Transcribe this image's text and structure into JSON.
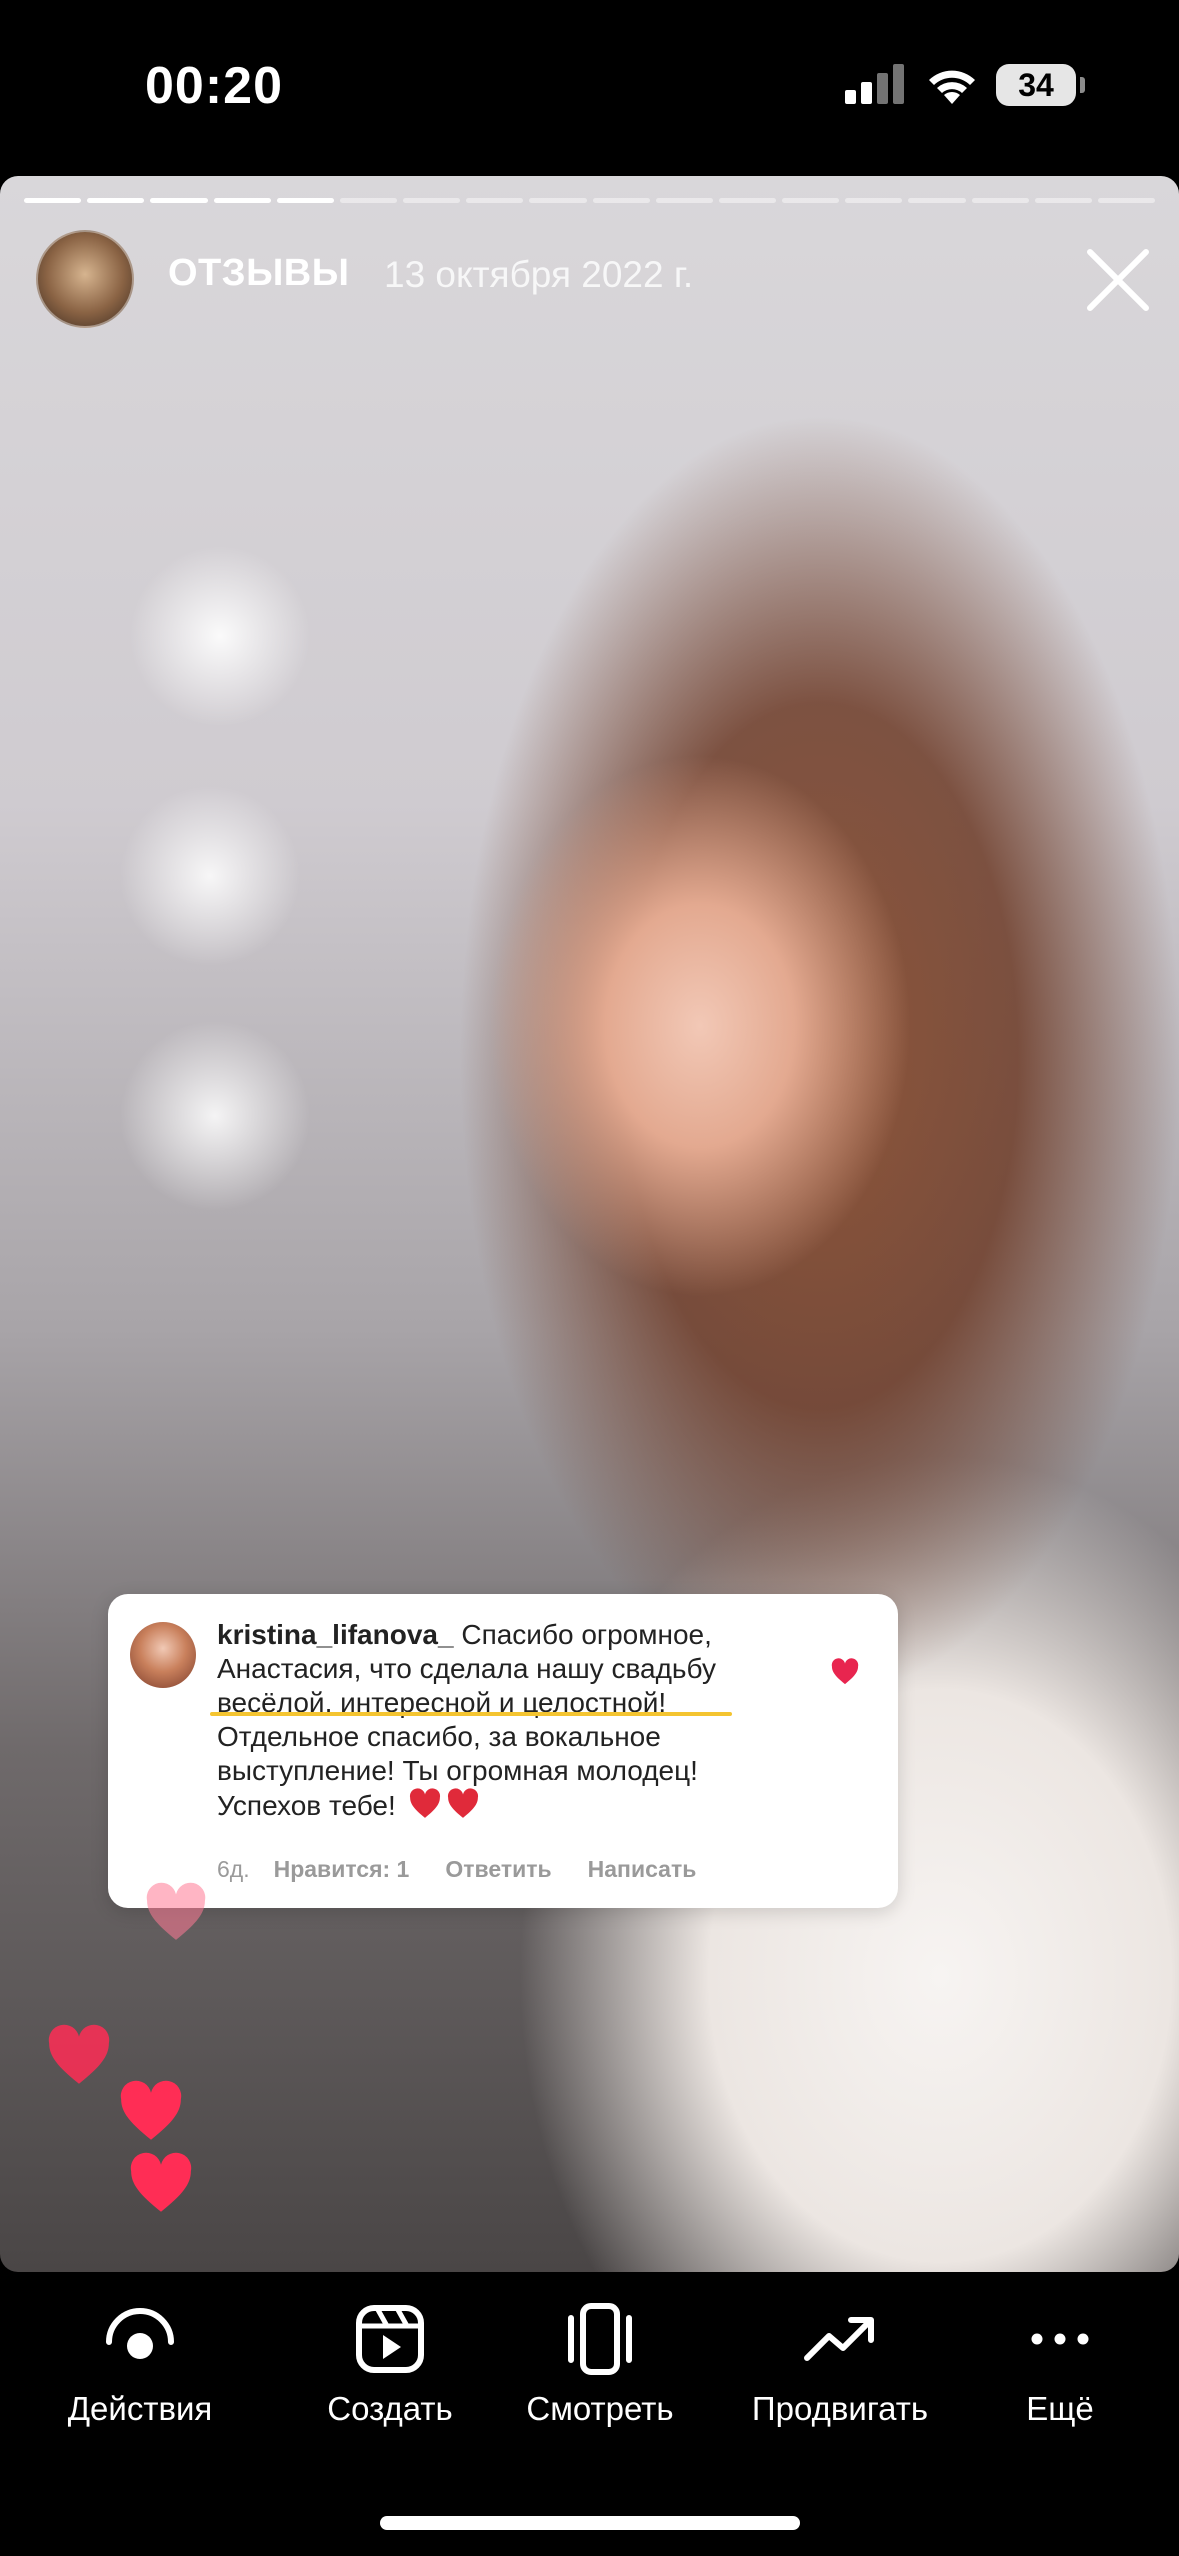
{
  "status_bar": {
    "time": "00:20",
    "battery": "34",
    "icons": [
      "cellular-signal-icon",
      "wifi-icon",
      "battery-icon"
    ]
  },
  "story": {
    "progress": {
      "segments": 18,
      "completed": 5
    },
    "username": "ОТЗЫВЫ",
    "date": "13 октября 2022 г.",
    "close_icon": "close-icon"
  },
  "comment": {
    "username": "kristina_lifanova_",
    "text_line1": " Спасибо огромное,",
    "text_line2": "Анастасия, что сделала нашу свадьбу",
    "text_line3": "весёлой, интересной и целостной!",
    "text_line4": "Отдельное спасибо, за вокальное",
    "text_line5": "выступление! Ты огромная молодец!",
    "text_line6": "Успехов тебе!",
    "time": "6д.",
    "likes": "Нравится: 1",
    "reply": "Ответить",
    "message": "Написать",
    "heart_color": "#e8254f"
  },
  "toolbar": {
    "items": [
      {
        "label": "Действия",
        "icon": "activity-icon"
      },
      {
        "label": "Создать",
        "icon": "create-reel-icon"
      },
      {
        "label": "Смотреть",
        "icon": "view-icon"
      },
      {
        "label": "Продвигать",
        "icon": "promote-icon"
      },
      {
        "label": "Ещё",
        "icon": "more-icon"
      }
    ]
  },
  "colors": {
    "heart": "#ff2d55",
    "background": "#000000",
    "highlight": "#f4c430"
  }
}
